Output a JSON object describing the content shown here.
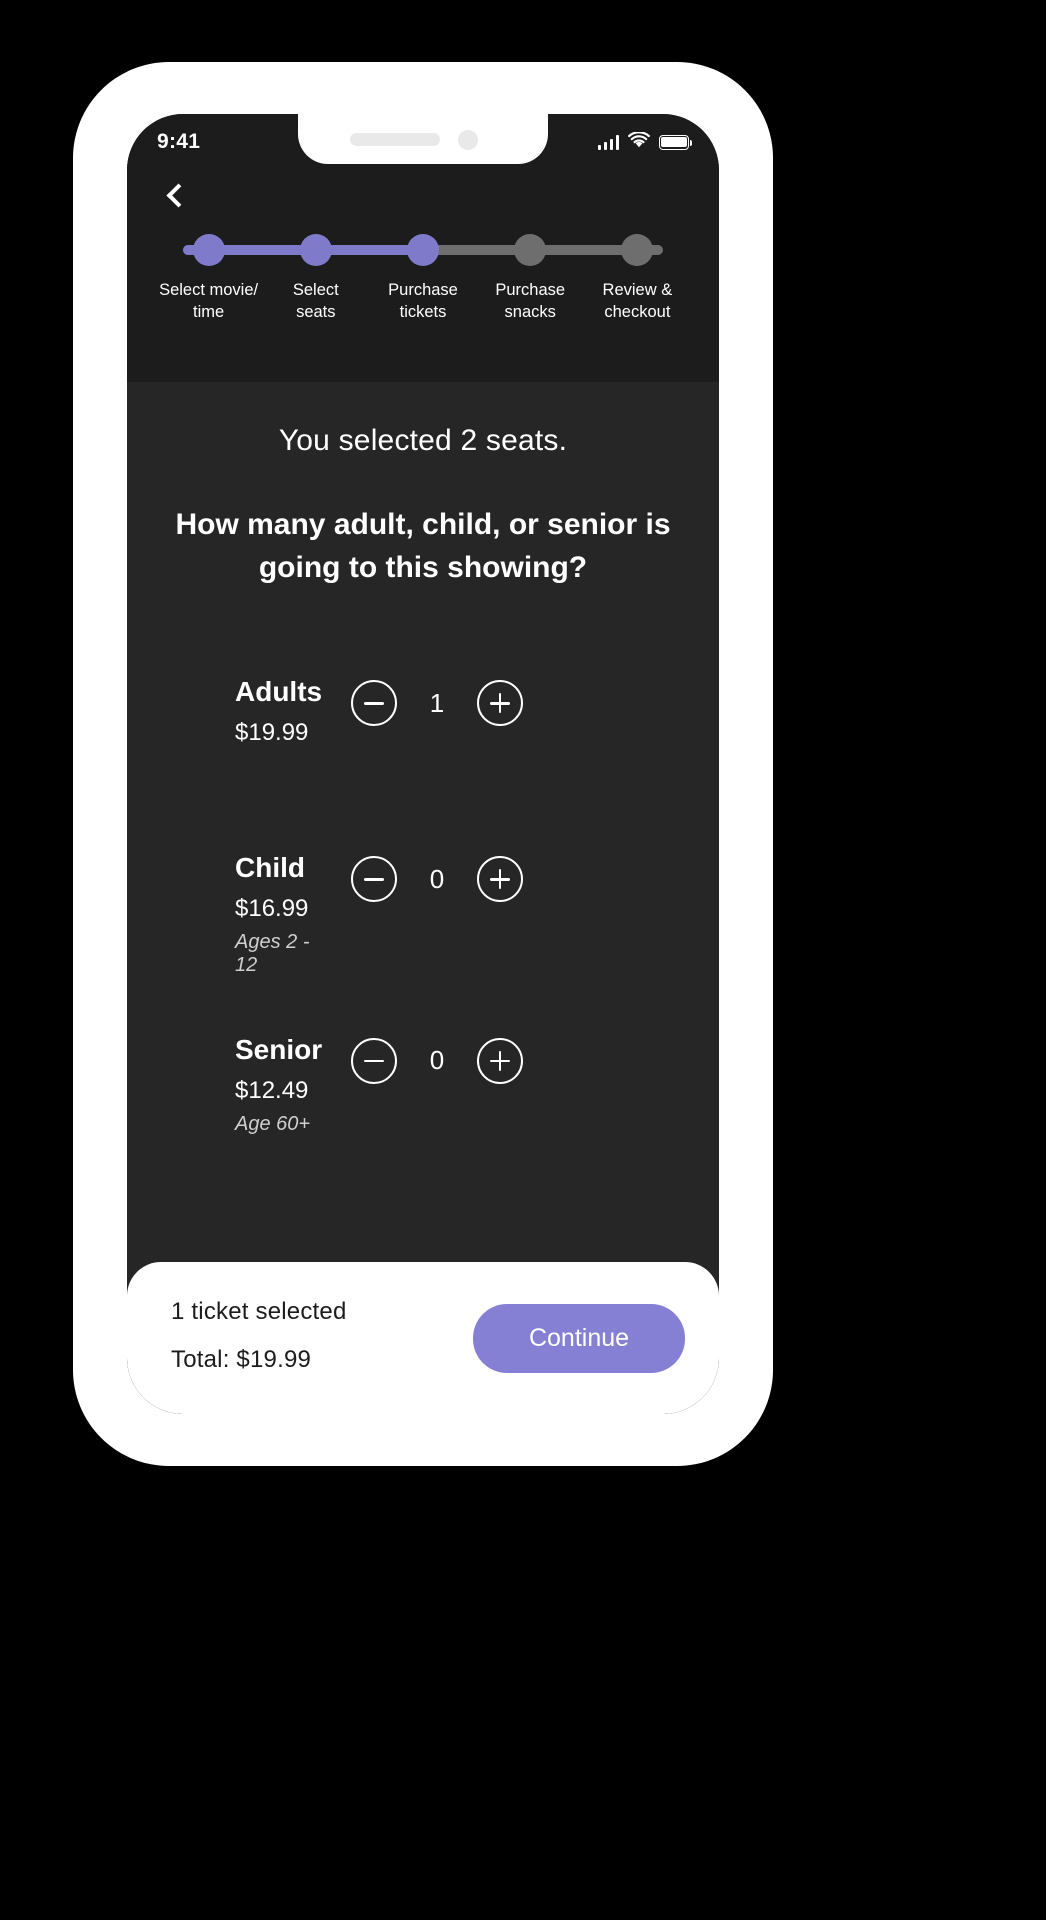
{
  "status_bar": {
    "time": "9:41",
    "icons": [
      "signal-bars-icon",
      "wifi-icon",
      "battery-icon"
    ]
  },
  "header": {
    "back_icon": "chevron-left-icon",
    "stepper": {
      "steps": [
        {
          "label": "Select movie/\ntime",
          "state": "done"
        },
        {
          "label": "Select\nseats",
          "state": "done"
        },
        {
          "label": "Purchase\ntickets",
          "state": "current"
        },
        {
          "label": "Purchase\nsnacks",
          "state": "upcoming"
        },
        {
          "label": "Review &\ncheckout",
          "state": "upcoming"
        }
      ],
      "active_color": "#7f7ac9",
      "inactive_color": "#6e6e6e"
    }
  },
  "main": {
    "seats_selected_text": "You selected 2 seats.",
    "question": "How many adult, child, or senior is going to this showing?",
    "tickets": [
      {
        "name": "Adults",
        "price": "$19.99",
        "note": "",
        "count": "1"
      },
      {
        "name": "Child",
        "price": "$16.99",
        "note": "Ages 2 - 12",
        "count": "0"
      },
      {
        "name": "Senior",
        "price": "$12.49",
        "note": "Age 60+",
        "count": "0"
      }
    ]
  },
  "bottom_bar": {
    "tickets_selected": "1  ticket selected",
    "total": "Total:  $19.99",
    "continue_label": "Continue",
    "accent_color": "#8580d4"
  }
}
